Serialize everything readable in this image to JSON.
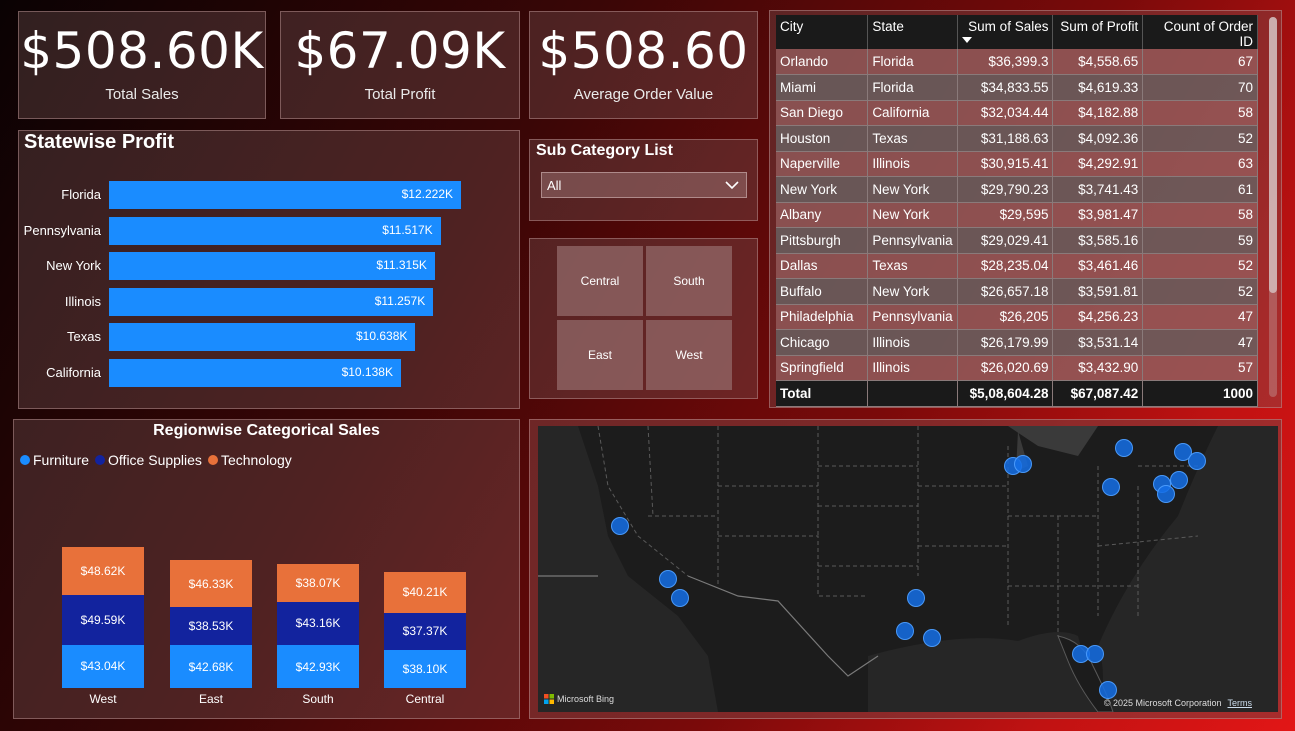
{
  "kpis": [
    {
      "value": "$508.60K",
      "label": "Total Sales"
    },
    {
      "value": "$67.09K",
      "label": "Total Profit"
    },
    {
      "value": "$508.60",
      "label": "Average Order Value"
    }
  ],
  "statewise": {
    "title": "Statewise Profit",
    "bars": [
      {
        "state": "Florida",
        "label": "$12.222K",
        "value": 12.222
      },
      {
        "state": "Pennsylvania",
        "label": "$11.517K",
        "value": 11.517
      },
      {
        "state": "New York",
        "label": "$11.315K",
        "value": 11.315
      },
      {
        "state": "Illinois",
        "label": "$11.257K",
        "value": 11.257
      },
      {
        "state": "Texas",
        "label": "$10.638K",
        "value": 10.638
      },
      {
        "state": "California",
        "label": "$10.138K",
        "value": 10.138
      }
    ]
  },
  "slicer": {
    "title": "Sub Category List",
    "selected": "All"
  },
  "regions": {
    "tiles": [
      "Central",
      "South",
      "East",
      "West"
    ]
  },
  "table": {
    "columns": [
      "City",
      "State",
      "Sum of Sales",
      "Sum of Profit",
      "Count of Order ID"
    ],
    "rows": [
      [
        "Orlando",
        "Florida",
        "$36,399.3",
        "$4,558.65",
        "67"
      ],
      [
        "Miami",
        "Florida",
        "$34,833.55",
        "$4,619.33",
        "70"
      ],
      [
        "San Diego",
        "California",
        "$32,034.44",
        "$4,182.88",
        "58"
      ],
      [
        "Houston",
        "Texas",
        "$31,188.63",
        "$4,092.36",
        "52"
      ],
      [
        "Naperville",
        "Illinois",
        "$30,915.41",
        "$4,292.91",
        "63"
      ],
      [
        "New York",
        "New York",
        "$29,790.23",
        "$3,741.43",
        "61"
      ],
      [
        "Albany",
        "New York",
        "$29,595",
        "$3,981.47",
        "58"
      ],
      [
        "Pittsburgh",
        "Pennsylvania",
        "$29,029.41",
        "$3,585.16",
        "59"
      ],
      [
        "Dallas",
        "Texas",
        "$28,235.04",
        "$3,461.46",
        "52"
      ],
      [
        "Buffalo",
        "New York",
        "$26,657.18",
        "$3,591.81",
        "52"
      ],
      [
        "Philadelphia",
        "Pennsylvania",
        "$26,205",
        "$4,256.23",
        "47"
      ],
      [
        "Chicago",
        "Illinois",
        "$26,179.99",
        "$3,531.14",
        "47"
      ],
      [
        "Springfield",
        "Illinois",
        "$26,020.69",
        "$3,432.90",
        "57"
      ]
    ],
    "total": [
      "Total",
      "",
      "$5,08,604.28",
      "$67,087.42",
      "1000"
    ]
  },
  "regional": {
    "title": "Regionwise Categorical Sales",
    "legend": [
      {
        "name": "Furniture",
        "color": "#1a8cff"
      },
      {
        "name": "Office Supplies",
        "color": "#12239e"
      },
      {
        "name": "Technology",
        "color": "#e8713a"
      }
    ]
  },
  "chart_data": {
    "type": "bar",
    "title": "Regionwise Categorical Sales",
    "stacked": true,
    "categories": [
      "West",
      "East",
      "South",
      "Central"
    ],
    "series": [
      {
        "name": "Furniture",
        "values": [
          43.04,
          42.68,
          42.93,
          38.1
        ],
        "labels": [
          "$43.04K",
          "$42.68K",
          "$42.93K",
          "$38.10K"
        ]
      },
      {
        "name": "Office Supplies",
        "values": [
          49.59,
          38.53,
          43.16,
          37.37
        ],
        "labels": [
          "$49.59K",
          "$38.53K",
          "$43.16K",
          "$37.37K"
        ]
      },
      {
        "name": "Technology",
        "values": [
          48.62,
          46.33,
          38.07,
          40.21
        ],
        "labels": [
          "$48.62K",
          "$46.33K",
          "$38.07K",
          "$40.21K"
        ]
      }
    ]
  },
  "map": {
    "attribution": "Microsoft Bing",
    "copyright": "© 2025 Microsoft Corporation",
    "terms": "Terms"
  }
}
